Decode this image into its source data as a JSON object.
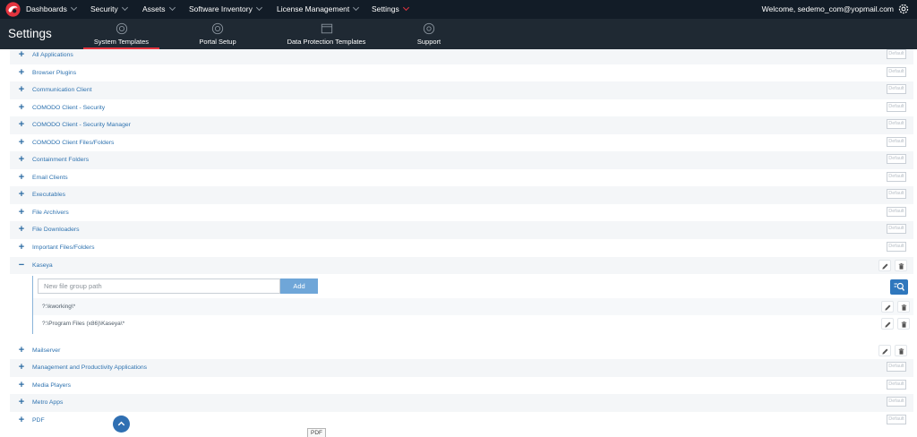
{
  "topnav": {
    "items": [
      {
        "label": "Dashboards"
      },
      {
        "label": "Security"
      },
      {
        "label": "Assets"
      },
      {
        "label": "Software Inventory"
      },
      {
        "label": "License Management"
      },
      {
        "label": "Settings"
      }
    ],
    "welcome": "Welcome, sedemo_com@yopmail.com",
    "accent_color": "#e3343f"
  },
  "settings": {
    "title": "Settings",
    "tabs": [
      {
        "label": "System Templates",
        "icon": "gear-icon",
        "active": true
      },
      {
        "label": "Portal Setup",
        "icon": "gear-icon",
        "active": false
      },
      {
        "label": "Data Protection Templates",
        "icon": "window-icon",
        "active": false
      },
      {
        "label": "Support",
        "icon": "support-icon",
        "active": false
      }
    ]
  },
  "groups": [
    {
      "name": "All Applications",
      "button": "Default"
    },
    {
      "name": "Browser Plugins",
      "button": "Default"
    },
    {
      "name": "Communication Client",
      "button": "Default"
    },
    {
      "name": "COMODO Client - Security",
      "button": "Default"
    },
    {
      "name": "COMODO Client - Security Manager",
      "button": "Default"
    },
    {
      "name": "COMODO Client Files/Folders",
      "button": "Default"
    },
    {
      "name": "Containment Folders",
      "button": "Default"
    },
    {
      "name": "Email Clients",
      "button": "Default"
    },
    {
      "name": "Executables",
      "button": "Default"
    },
    {
      "name": "File Archivers",
      "button": "Default"
    },
    {
      "name": "File Downloaders",
      "button": "Default"
    },
    {
      "name": "Important Files/Folders",
      "button": "Default"
    },
    {
      "name": "Kaseya",
      "expanded": true
    },
    {
      "name": "Mailserver"
    },
    {
      "name": "Management and Productivity Applications",
      "button": "Default"
    },
    {
      "name": "Media Players",
      "button": "Default"
    },
    {
      "name": "Metro Apps",
      "button": "Default"
    },
    {
      "name": "PDF",
      "button": "Default"
    }
  ],
  "kaseya": {
    "placeholder": "New file group path",
    "add_label": "Add",
    "paths": [
      "?:\\kworking\\*",
      "?:\\Program Files (x86)\\Kaseya\\*"
    ]
  },
  "tooltip": "PDF"
}
